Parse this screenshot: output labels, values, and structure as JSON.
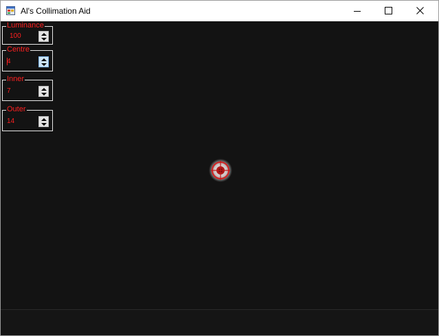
{
  "window": {
    "title": "Al's Collimation Aid",
    "icon": "app-window-icon",
    "controls": [
      "minimize-icon",
      "maximize-icon",
      "close-icon"
    ]
  },
  "controls": {
    "luminance": {
      "label": "Luminance",
      "value": "100"
    },
    "centre": {
      "label": "Centre",
      "value": "4"
    },
    "inner": {
      "label": "Inner",
      "value": "7"
    },
    "outer": {
      "label": "Outer",
      "value": "14"
    }
  },
  "colors": {
    "background": "#131313",
    "accent": "#ff2020",
    "group_border": "#e8e8e8"
  }
}
